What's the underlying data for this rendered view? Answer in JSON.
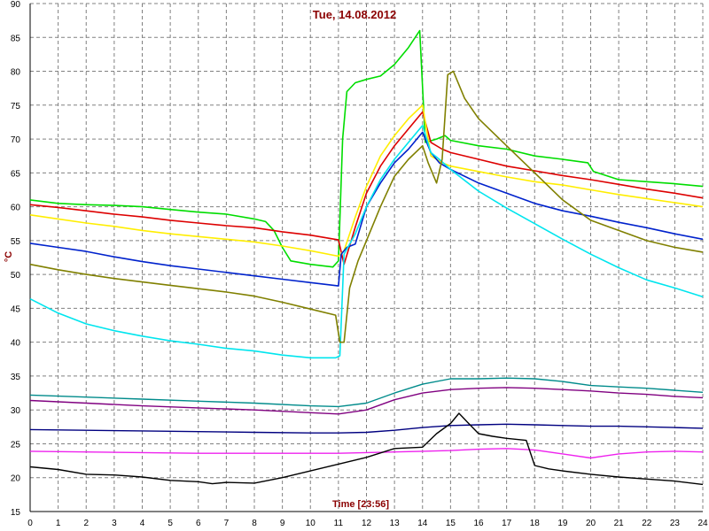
{
  "chart_data": {
    "type": "line",
    "title": "Tue, 14.08.2012",
    "xlabel": "Time [23:56]",
    "ylabel": "°C",
    "xlim": [
      0,
      24
    ],
    "ylim": [
      15,
      90
    ],
    "x_ticks": [
      0,
      1,
      2,
      3,
      4,
      5,
      6,
      7,
      8,
      9,
      10,
      11,
      12,
      13,
      14,
      15,
      16,
      17,
      18,
      19,
      20,
      21,
      22,
      23,
      24
    ],
    "y_ticks": [
      15,
      20,
      25,
      30,
      35,
      40,
      45,
      50,
      55,
      60,
      65,
      70,
      75,
      80,
      85,
      90
    ],
    "grid": true,
    "grid_style": "dashed",
    "background": "#ffffff",
    "grid_color": "#808080",
    "series": [
      {
        "color": "#00dd00",
        "width": 1.6,
        "points": [
          [
            0,
            61
          ],
          [
            1,
            60.5
          ],
          [
            2,
            60.3
          ],
          [
            3,
            60.2
          ],
          [
            4,
            60
          ],
          [
            5,
            59.6
          ],
          [
            6,
            59.2
          ],
          [
            7,
            58.9
          ],
          [
            8,
            58.2
          ],
          [
            8.4,
            57.8
          ],
          [
            8.7,
            56.5
          ],
          [
            9,
            54
          ],
          [
            9.3,
            52
          ],
          [
            10,
            51.5
          ],
          [
            10.8,
            51.1
          ],
          [
            11.0,
            52
          ],
          [
            11.15,
            70
          ],
          [
            11.3,
            77
          ],
          [
            11.6,
            78.3
          ],
          [
            12,
            78.8
          ],
          [
            12.5,
            79.3
          ],
          [
            13,
            81
          ],
          [
            13.5,
            83.5
          ],
          [
            13.9,
            86
          ],
          [
            14.1,
            69.5
          ],
          [
            14.5,
            70
          ],
          [
            14.8,
            70.5
          ],
          [
            15.0,
            69.8
          ],
          [
            16,
            69
          ],
          [
            17,
            68.5
          ],
          [
            18,
            67.5
          ],
          [
            19,
            67
          ],
          [
            19.9,
            66.5
          ],
          [
            20.1,
            65.2
          ],
          [
            21,
            64
          ],
          [
            22,
            63.7
          ],
          [
            23,
            63.4
          ],
          [
            24,
            63
          ]
        ]
      },
      {
        "color": "#dd0000",
        "width": 1.6,
        "points": [
          [
            0,
            60.3
          ],
          [
            1,
            59.9
          ],
          [
            2,
            59.4
          ],
          [
            3,
            58.9
          ],
          [
            4,
            58.5
          ],
          [
            5,
            58
          ],
          [
            6,
            57.6
          ],
          [
            7,
            57.2
          ],
          [
            8,
            56.9
          ],
          [
            9,
            56.3
          ],
          [
            10,
            55.8
          ],
          [
            11,
            55.1
          ],
          [
            11.2,
            51.5
          ],
          [
            11.6,
            57
          ],
          [
            12,
            62
          ],
          [
            12.5,
            66
          ],
          [
            13,
            69
          ],
          [
            13.5,
            71.5
          ],
          [
            14,
            74
          ],
          [
            14.3,
            69.5
          ],
          [
            14.7,
            68.5
          ],
          [
            15,
            68
          ],
          [
            16,
            67
          ],
          [
            17,
            66
          ],
          [
            18,
            65.3
          ],
          [
            19,
            64.6
          ],
          [
            20,
            64
          ],
          [
            21,
            63.3
          ],
          [
            22,
            62.6
          ],
          [
            23,
            62
          ],
          [
            24,
            61.3
          ]
        ]
      },
      {
        "color": "#ffee00",
        "width": 1.6,
        "points": [
          [
            0,
            58.8
          ],
          [
            1,
            58.2
          ],
          [
            2,
            57.6
          ],
          [
            3,
            57.1
          ],
          [
            4,
            56.5
          ],
          [
            5,
            56
          ],
          [
            6,
            55.6
          ],
          [
            7,
            55.2
          ],
          [
            8,
            54.8
          ],
          [
            9,
            54.2
          ],
          [
            10,
            53.5
          ],
          [
            11,
            52.7
          ],
          [
            11.2,
            53.5
          ],
          [
            11.6,
            58.5
          ],
          [
            12,
            63
          ],
          [
            12.5,
            67.5
          ],
          [
            13,
            70.5
          ],
          [
            13.5,
            73
          ],
          [
            14,
            75
          ],
          [
            14.3,
            67.5
          ],
          [
            14.7,
            66.5
          ],
          [
            15,
            66
          ],
          [
            16,
            65.2
          ],
          [
            17,
            64.4
          ],
          [
            18,
            63.7
          ],
          [
            19,
            63.2
          ],
          [
            20,
            62.5
          ],
          [
            21,
            61.8
          ],
          [
            22,
            61.2
          ],
          [
            23,
            60.6
          ],
          [
            24,
            60
          ]
        ]
      },
      {
        "color": "#0022cc",
        "width": 1.6,
        "points": [
          [
            0,
            54.6
          ],
          [
            1,
            54
          ],
          [
            2,
            53.4
          ],
          [
            3,
            52.6
          ],
          [
            4,
            51.9
          ],
          [
            5,
            51.3
          ],
          [
            6,
            50.8
          ],
          [
            7,
            50.3
          ],
          [
            8,
            49.8
          ],
          [
            9,
            49.3
          ],
          [
            10,
            48.8
          ],
          [
            11,
            48.3
          ],
          [
            11.1,
            53
          ],
          [
            11.3,
            54
          ],
          [
            11.6,
            54.5
          ],
          [
            12,
            60
          ],
          [
            12.5,
            63.5
          ],
          [
            13,
            66.5
          ],
          [
            13.5,
            68.5
          ],
          [
            14,
            71
          ],
          [
            14.3,
            68
          ],
          [
            14.6,
            66.5
          ],
          [
            15,
            65.5
          ],
          [
            16,
            63.5
          ],
          [
            17,
            62
          ],
          [
            18,
            60.5
          ],
          [
            19,
            59.4
          ],
          [
            20,
            58.6
          ],
          [
            21,
            57.7
          ],
          [
            22,
            56.9
          ],
          [
            23,
            56
          ],
          [
            24,
            55.2
          ]
        ]
      },
      {
        "color": "#00e5ee",
        "width": 1.6,
        "points": [
          [
            0,
            46.4
          ],
          [
            1,
            44.3
          ],
          [
            2,
            42.7
          ],
          [
            3,
            41.7
          ],
          [
            4,
            40.9
          ],
          [
            5,
            40.2
          ],
          [
            6,
            39.7
          ],
          [
            7,
            39.1
          ],
          [
            8,
            38.7
          ],
          [
            9,
            38.1
          ],
          [
            10,
            37.7
          ],
          [
            10.9,
            37.7
          ],
          [
            11.05,
            38
          ],
          [
            11.2,
            53
          ],
          [
            11.6,
            56
          ],
          [
            12,
            60
          ],
          [
            12.5,
            64
          ],
          [
            13,
            67
          ],
          [
            13.5,
            69.5
          ],
          [
            14,
            72
          ],
          [
            14.3,
            68
          ],
          [
            14.6,
            67
          ],
          [
            15,
            65.5
          ],
          [
            16,
            62.3
          ],
          [
            17,
            59.8
          ],
          [
            18,
            57.5
          ],
          [
            19,
            55.2
          ],
          [
            20,
            53
          ],
          [
            21,
            51
          ],
          [
            22,
            49.2
          ],
          [
            23,
            48
          ],
          [
            24,
            46.7
          ]
        ]
      },
      {
        "color": "#808000",
        "width": 1.6,
        "points": [
          [
            0,
            51.5
          ],
          [
            1,
            50.7
          ],
          [
            2,
            50
          ],
          [
            3,
            49.4
          ],
          [
            4,
            48.9
          ],
          [
            5,
            48.4
          ],
          [
            6,
            47.9
          ],
          [
            7,
            47.4
          ],
          [
            8,
            46.8
          ],
          [
            9,
            45.9
          ],
          [
            10,
            44.9
          ],
          [
            10.9,
            44
          ],
          [
            11.05,
            40
          ],
          [
            11.2,
            40
          ],
          [
            11.4,
            48
          ],
          [
            11.7,
            52
          ],
          [
            12,
            55
          ],
          [
            12.5,
            60
          ],
          [
            13,
            64.5
          ],
          [
            13.5,
            67
          ],
          [
            14,
            69
          ],
          [
            14.2,
            66.5
          ],
          [
            14.5,
            63.5
          ],
          [
            14.7,
            67
          ],
          [
            14.9,
            79.5
          ],
          [
            15.1,
            80
          ],
          [
            15.5,
            76
          ],
          [
            16,
            73
          ],
          [
            17,
            69
          ],
          [
            18,
            65
          ],
          [
            19,
            61
          ],
          [
            20,
            58
          ],
          [
            21,
            56.5
          ],
          [
            22,
            55
          ],
          [
            23,
            54
          ],
          [
            24,
            53.3
          ]
        ]
      },
      {
        "color": "#008b8b",
        "width": 1.4,
        "points": [
          [
            0,
            32.2
          ],
          [
            2,
            31.9
          ],
          [
            4,
            31.6
          ],
          [
            6,
            31.3
          ],
          [
            8,
            31
          ],
          [
            10,
            30.6
          ],
          [
            11,
            30.5
          ],
          [
            12,
            31
          ],
          [
            13,
            32.5
          ],
          [
            14,
            33.8
          ],
          [
            15,
            34.6
          ],
          [
            16,
            34.6
          ],
          [
            17,
            34.7
          ],
          [
            18,
            34.6
          ],
          [
            19,
            34.2
          ],
          [
            20,
            33.6
          ],
          [
            21,
            33.4
          ],
          [
            22,
            33.2
          ],
          [
            23,
            32.9
          ],
          [
            24,
            32.6
          ]
        ]
      },
      {
        "color": "#800080",
        "width": 1.4,
        "points": [
          [
            0,
            31.4
          ],
          [
            2,
            31
          ],
          [
            4,
            30.6
          ],
          [
            6,
            30.3
          ],
          [
            8,
            30
          ],
          [
            10,
            29.6
          ],
          [
            11,
            29.4
          ],
          [
            12,
            30
          ],
          [
            13,
            31.5
          ],
          [
            14,
            32.5
          ],
          [
            15,
            33
          ],
          [
            16,
            33.2
          ],
          [
            17,
            33.3
          ],
          [
            18,
            33.2
          ],
          [
            19,
            33
          ],
          [
            20,
            32.8
          ],
          [
            21,
            32.5
          ],
          [
            22,
            32.3
          ],
          [
            23,
            32
          ],
          [
            24,
            31.8
          ]
        ]
      },
      {
        "color": "#000080",
        "width": 1.4,
        "points": [
          [
            0,
            27.1
          ],
          [
            2,
            27
          ],
          [
            4,
            26.9
          ],
          [
            6,
            26.8
          ],
          [
            8,
            26.7
          ],
          [
            10,
            26.6
          ],
          [
            11,
            26.6
          ],
          [
            12,
            26.7
          ],
          [
            13,
            27
          ],
          [
            14,
            27.4
          ],
          [
            15,
            27.7
          ],
          [
            16,
            27.8
          ],
          [
            17,
            27.9
          ],
          [
            18,
            27.8
          ],
          [
            19,
            27.7
          ],
          [
            20,
            27.6
          ],
          [
            21,
            27.6
          ],
          [
            22,
            27.5
          ],
          [
            23,
            27.4
          ],
          [
            24,
            27.3
          ]
        ]
      },
      {
        "color": "#ee22ee",
        "width": 1.4,
        "points": [
          [
            0,
            23.9
          ],
          [
            2,
            23.8
          ],
          [
            4,
            23.7
          ],
          [
            6,
            23.6
          ],
          [
            8,
            23.6
          ],
          [
            10,
            23.6
          ],
          [
            11,
            23.6
          ],
          [
            12,
            23.7
          ],
          [
            13,
            23.8
          ],
          [
            14,
            23.9
          ],
          [
            15,
            24
          ],
          [
            16,
            24.2
          ],
          [
            17,
            24.3
          ],
          [
            18,
            24.1
          ],
          [
            19,
            23.5
          ],
          [
            20,
            22.9
          ],
          [
            20.5,
            23.2
          ],
          [
            21,
            23.5
          ],
          [
            22,
            23.8
          ],
          [
            23,
            23.9
          ],
          [
            24,
            23.8
          ]
        ]
      },
      {
        "color": "#000000",
        "width": 1.4,
        "points": [
          [
            0,
            21.6
          ],
          [
            1,
            21.2
          ],
          [
            2,
            20.5
          ],
          [
            3,
            20.4
          ],
          [
            4,
            20.1
          ],
          [
            5,
            19.6
          ],
          [
            6,
            19.4
          ],
          [
            6.5,
            19.1
          ],
          [
            7,
            19.3
          ],
          [
            8,
            19.2
          ],
          [
            9,
            20
          ],
          [
            10,
            21
          ],
          [
            11,
            22
          ],
          [
            12,
            23
          ],
          [
            13,
            24.3
          ],
          [
            14,
            24.5
          ],
          [
            14.5,
            26.5
          ],
          [
            15,
            28
          ],
          [
            15.3,
            29.5
          ],
          [
            15.6,
            28.2
          ],
          [
            16,
            26.5
          ],
          [
            16.5,
            26.1
          ],
          [
            17,
            25.8
          ],
          [
            17.7,
            25.5
          ],
          [
            18,
            21.8
          ],
          [
            18.5,
            21.3
          ],
          [
            19,
            21
          ],
          [
            20,
            20.5
          ],
          [
            21,
            20.1
          ],
          [
            22,
            19.8
          ],
          [
            23,
            19.5
          ],
          [
            24,
            19
          ]
        ]
      }
    ]
  }
}
